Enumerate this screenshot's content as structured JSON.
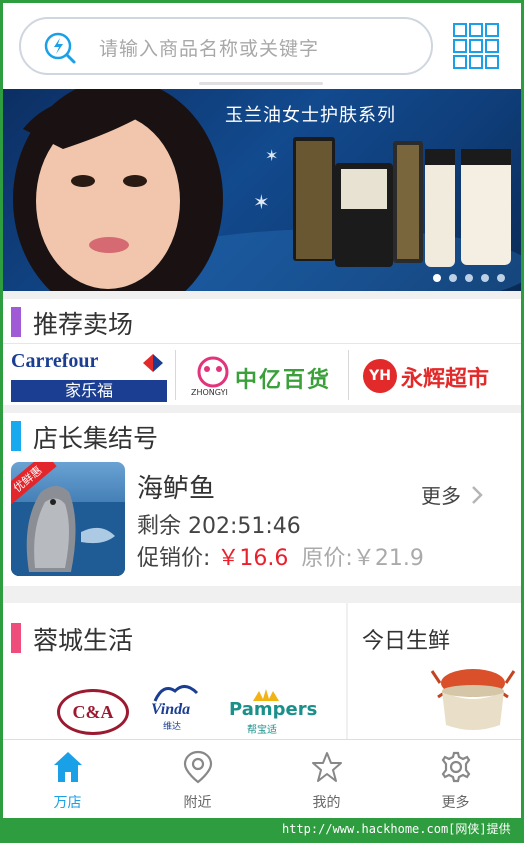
{
  "search": {
    "placeholder": "请输入商品名称或关键字"
  },
  "banner": {
    "title": "玉兰油女士护肤系列",
    "slides": 5,
    "active_slide": 0
  },
  "sections": {
    "recommended": {
      "title": "推荐卖场",
      "accent": "#a05ad6"
    },
    "store_manager": {
      "title": "店长集结号",
      "accent": "#19a9ef"
    },
    "rongcheng": {
      "title": "蓉城生活",
      "accent": "#ef4e7c"
    },
    "today_fresh": {
      "title": "今日生鲜"
    }
  },
  "malls": [
    {
      "name": "Carrefour",
      "subtitle": "家乐福"
    },
    {
      "name": "中亿百货",
      "subtitle": "ZHONGYI"
    },
    {
      "name": "YH",
      "subtitle": "永辉超市"
    }
  ],
  "promo": {
    "name": "海鲈鱼",
    "remaining": "剩余 202:51:46",
    "price_label": "促销价:",
    "price": "￥16.6",
    "orig_label": "原价:",
    "orig_price": "￥21.9",
    "more": "更多",
    "tag": "优鲜惠"
  },
  "brands": [
    {
      "name": "C&A"
    },
    {
      "name": "Vinda",
      "subtitle": "维达"
    },
    {
      "name": "Pampers",
      "subtitle": "帮宝适"
    }
  ],
  "tabs": [
    {
      "label": "万店",
      "icon": "home-icon",
      "active": true
    },
    {
      "label": "附近",
      "icon": "location-pin-icon",
      "active": false
    },
    {
      "label": "我的",
      "icon": "star-icon",
      "active": false
    },
    {
      "label": "更多",
      "icon": "gear-icon",
      "active": false
    }
  ],
  "footer": {
    "url": "http://www.hackhome.com[网侠]提供"
  },
  "colors": {
    "accent_blue": "#1aa0e6",
    "price_red": "#e8212c"
  }
}
